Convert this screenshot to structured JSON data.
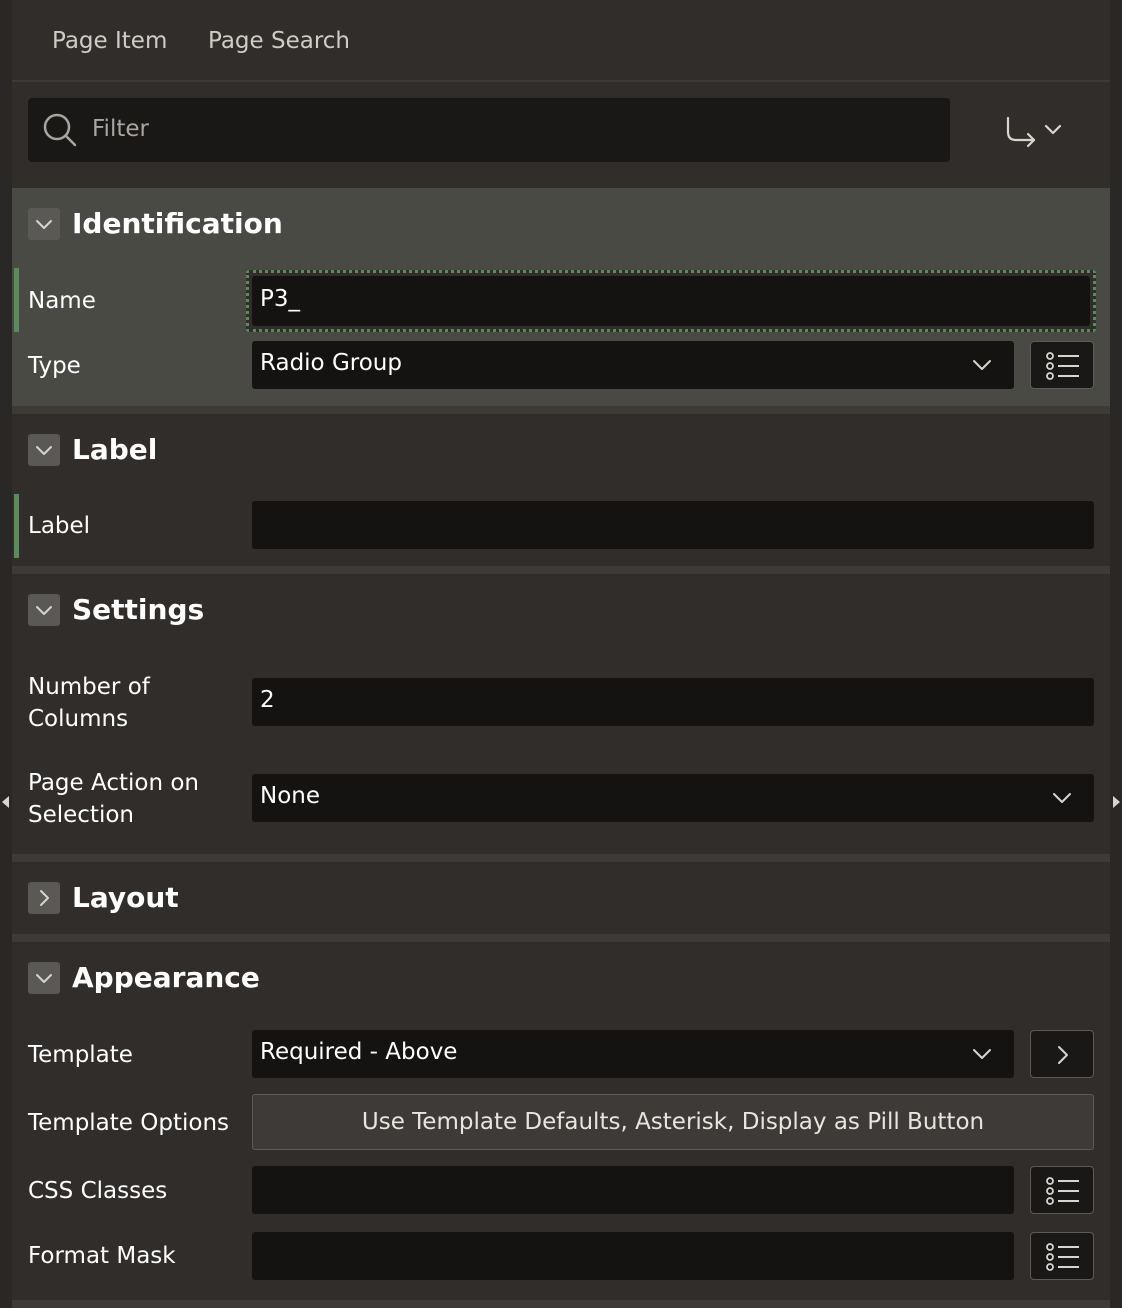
{
  "tabs": [
    "Page Item",
    "Page Search"
  ],
  "filter": {
    "placeholder": "Filter"
  },
  "sections": {
    "identification": {
      "title": "Identification",
      "name_label": "Name",
      "name_value": "P3_",
      "type_label": "Type",
      "type_value": "Radio Group"
    },
    "label": {
      "title": "Label",
      "label_label": "Label",
      "label_value": ""
    },
    "settings": {
      "title": "Settings",
      "columns_label_line1": "Number of",
      "columns_label_line2": "Columns",
      "columns_value": "2",
      "action_label_line1": "Page Action on",
      "action_label_line2": "Selection",
      "action_value": "None"
    },
    "layout": {
      "title": "Layout"
    },
    "appearance": {
      "title": "Appearance",
      "template_label": "Template",
      "template_value": "Required - Above",
      "template_options_label": "Template Options",
      "template_options_value": "Use Template Defaults, Asterisk, Display as Pill Button",
      "css_classes_label": "CSS Classes",
      "css_classes_value": "",
      "format_mask_label": "Format Mask",
      "format_mask_value": ""
    }
  },
  "colors": {
    "background": "#312d2a",
    "identification_bg": "#4a4a45",
    "field_bg": "#141312",
    "required_bar": "#5c8a5c",
    "focus_outline": "#5c8a5c"
  }
}
